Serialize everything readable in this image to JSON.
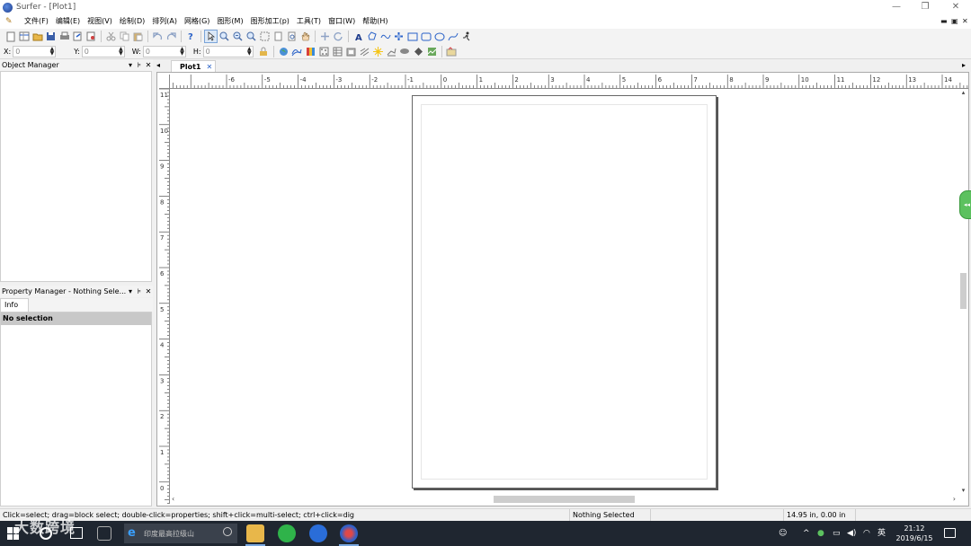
{
  "window": {
    "title": "Surfer - [Plot1]",
    "min_icon": "—",
    "restore_icon": "❐",
    "close_icon": "✕"
  },
  "menu": {
    "items": [
      "文件(F)",
      "编辑(E)",
      "视图(V)",
      "绘制(D)",
      "排列(A)",
      "网格(G)",
      "图形(M)",
      "图形加工(p)",
      "工具(T)",
      "窗口(W)",
      "帮助(H)"
    ],
    "mdi_min": "▬",
    "mdi_restore": "▣",
    "mdi_close": "✕"
  },
  "toolbar1": {
    "icons": [
      "new-doc-icon",
      "new-worksheet-icon",
      "open-icon",
      "save-icon",
      "print-icon",
      "export-icon",
      "import-icon",
      "cut-icon",
      "copy-icon",
      "paste-icon",
      "undo-icon",
      "redo-icon",
      "help-icon",
      "select-arrow-icon",
      "zoom-in-icon",
      "zoom-out-icon",
      "zoom-rect-icon",
      "zoom-extents-icon",
      "zoom-page-icon",
      "zoom-actual-icon",
      "pan-hand-icon",
      "move-icon",
      "rotate-icon",
      "text-icon",
      "polygon-icon",
      "polyline-icon",
      "symbol-icon",
      "rectangle-icon",
      "rounded-rect-icon",
      "ellipse-icon",
      "spline-icon",
      "runner-icon"
    ],
    "text_glyph": "A"
  },
  "toolbar2": {
    "x": {
      "label": "X:",
      "value": "0"
    },
    "y": {
      "label": "Y:",
      "value": "0"
    },
    "w": {
      "label": "W:",
      "value": "0"
    },
    "h": {
      "label": "H:",
      "value": "0"
    },
    "icons": [
      "lock-icon",
      "base-map-icon",
      "contour-map-icon",
      "color-relief-icon",
      "post-map-icon",
      "grid-node-icon",
      "classed-post-icon",
      "vector-map-icon",
      "surface-icon",
      "3d-wireframe-icon",
      "3d-surface-icon",
      "watershed-icon",
      "profile-icon"
    ]
  },
  "object_manager": {
    "title": "Object Manager"
  },
  "property_manager": {
    "title": "Property Manager - Nothing Sele...",
    "tab": "Info",
    "selection": "No selection"
  },
  "doc_tabs": {
    "active": "Plot1",
    "close": "✕",
    "left_arrow": "◂",
    "right_arrow": "▸"
  },
  "ruler": {
    "horizontal_labels": [
      "-6",
      "-5",
      "-4",
      "-3",
      "-2",
      "-1",
      "0",
      "1",
      "2",
      "3",
      "4",
      "5",
      "6",
      "7",
      "8",
      "9",
      "10",
      "11",
      "12",
      "13",
      "14"
    ],
    "vertical_labels": [
      "11",
      "10",
      "9",
      "8",
      "7",
      "6",
      "5",
      "4",
      "3",
      "2",
      "1",
      "0"
    ]
  },
  "status": {
    "hint": "Click=select; drag=block select; double-click=properties; shift+click=multi-select; ctrl+click=dig",
    "selection": "Nothing Selected",
    "coords": "14.95 in, 0.00 in"
  },
  "taskbar": {
    "search_placeholder": "印度最高拉级山",
    "tray_lang": "英",
    "time": "21:12",
    "date": "2019/6/15"
  },
  "watermark": "大数跨境",
  "colors": {
    "page_border": "#666666",
    "taskbar": "#1f2630",
    "accent": "#2a62c8"
  }
}
